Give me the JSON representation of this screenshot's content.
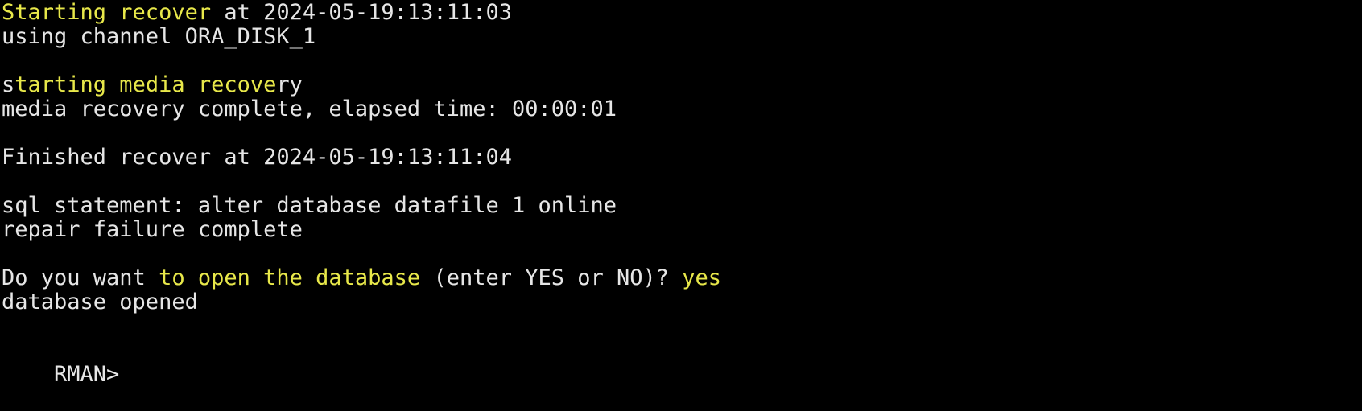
{
  "colors": {
    "background": "#000000",
    "text": "#e6e6e6",
    "highlight": "#e8e84a"
  },
  "terminal": {
    "lines": [
      {
        "segments": [
          {
            "text": "Starting recover",
            "hl": true
          },
          {
            "text": " at 2024-05-19:13:11:03",
            "hl": false
          }
        ]
      },
      {
        "segments": [
          {
            "text": "using channel ORA_DISK_1",
            "hl": false
          }
        ]
      },
      {
        "segments": [
          {
            "text": "",
            "hl": false
          }
        ]
      },
      {
        "segments": [
          {
            "text": "s",
            "hl": false
          },
          {
            "text": "tarting media recove",
            "hl": true
          },
          {
            "text": "ry",
            "hl": false
          }
        ]
      },
      {
        "segments": [
          {
            "text": "media recovery complete, elapsed time: 00:00:01",
            "hl": false
          }
        ]
      },
      {
        "segments": [
          {
            "text": "",
            "hl": false
          }
        ]
      },
      {
        "segments": [
          {
            "text": "Finished recover at 2024-05-19:13:11:04",
            "hl": false
          }
        ]
      },
      {
        "segments": [
          {
            "text": "",
            "hl": false
          }
        ]
      },
      {
        "segments": [
          {
            "text": "sql statement: alter database datafile 1 online",
            "hl": false
          }
        ]
      },
      {
        "segments": [
          {
            "text": "repair failure complete",
            "hl": false
          }
        ]
      },
      {
        "segments": [
          {
            "text": "",
            "hl": false
          }
        ]
      },
      {
        "segments": [
          {
            "text": "Do you want ",
            "hl": false
          },
          {
            "text": "to open the database",
            "hl": true
          },
          {
            "text": " (enter YES or NO)? ",
            "hl": false
          },
          {
            "text": "yes",
            "hl": true
          }
        ]
      },
      {
        "segments": [
          {
            "text": "database opened",
            "hl": false
          }
        ]
      },
      {
        "segments": [
          {
            "text": "",
            "hl": false
          }
        ]
      }
    ],
    "prompt": "RMAN>"
  }
}
